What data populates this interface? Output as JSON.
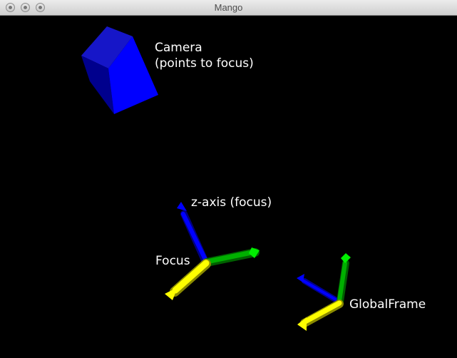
{
  "window": {
    "title": "Mango",
    "background": "#000000"
  },
  "titlebar_controls": {
    "close_icon": "circle-close",
    "minimize_icon": "circle-minimize",
    "zoom_icon": "circle-zoom"
  },
  "scene": {
    "camera_label_line1": "Camera",
    "camera_label_line2": "(points to focus)",
    "z_axis_label": "z-axis (focus)",
    "focus_label": "Focus",
    "global_frame_label": "GlobalFrame"
  },
  "colors": {
    "axis_x": "#ffff00",
    "axis_y": "#00cc00",
    "axis_z": "#0000ff",
    "camera": "#0000ff",
    "label": "#ffffff"
  }
}
